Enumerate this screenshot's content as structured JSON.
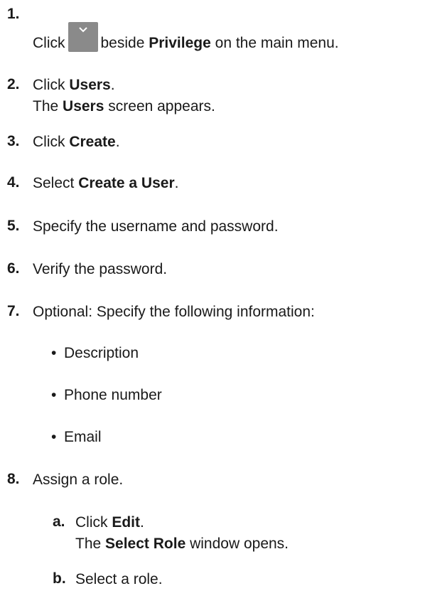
{
  "steps": [
    {
      "num": "1.",
      "pre": "Click",
      "bold": "Privilege",
      "mid": "beside",
      "post": "on the main menu.",
      "icon": "chevron-down-icon"
    },
    {
      "num": "2.",
      "pre": "Click",
      "bold": "Users",
      "post": ".",
      "line2_pre": "The",
      "line2_bold": "Users",
      "line2_post": "screen appears."
    },
    {
      "num": "3.",
      "pre": "Click",
      "bold": "Create",
      "post": "."
    },
    {
      "num": "4.",
      "pre": "Select",
      "bold": "Create a User",
      "post": "."
    },
    {
      "num": "5.",
      "text": "Specify the username and password."
    },
    {
      "num": "6.",
      "text": "Verify the password."
    },
    {
      "num": "7.",
      "text": "Optional: Specify the following information:"
    },
    {
      "num": "8.",
      "text": "Assign a role."
    }
  ],
  "bullets": [
    "Description",
    "Phone number",
    "Email"
  ],
  "bullet_symbol": "•",
  "substeps": [
    {
      "num": "a.",
      "pre": "Click",
      "bold": "Edit",
      "post": ".",
      "line2_pre": "The",
      "line2_bold": "Select Role",
      "line2_post": "window opens."
    },
    {
      "num": "b.",
      "text": "Select a role."
    }
  ],
  "colors": {
    "text": "#1a1a1a",
    "icon_button": "#8a8a8a",
    "icon_chevron": "#ffffff"
  }
}
